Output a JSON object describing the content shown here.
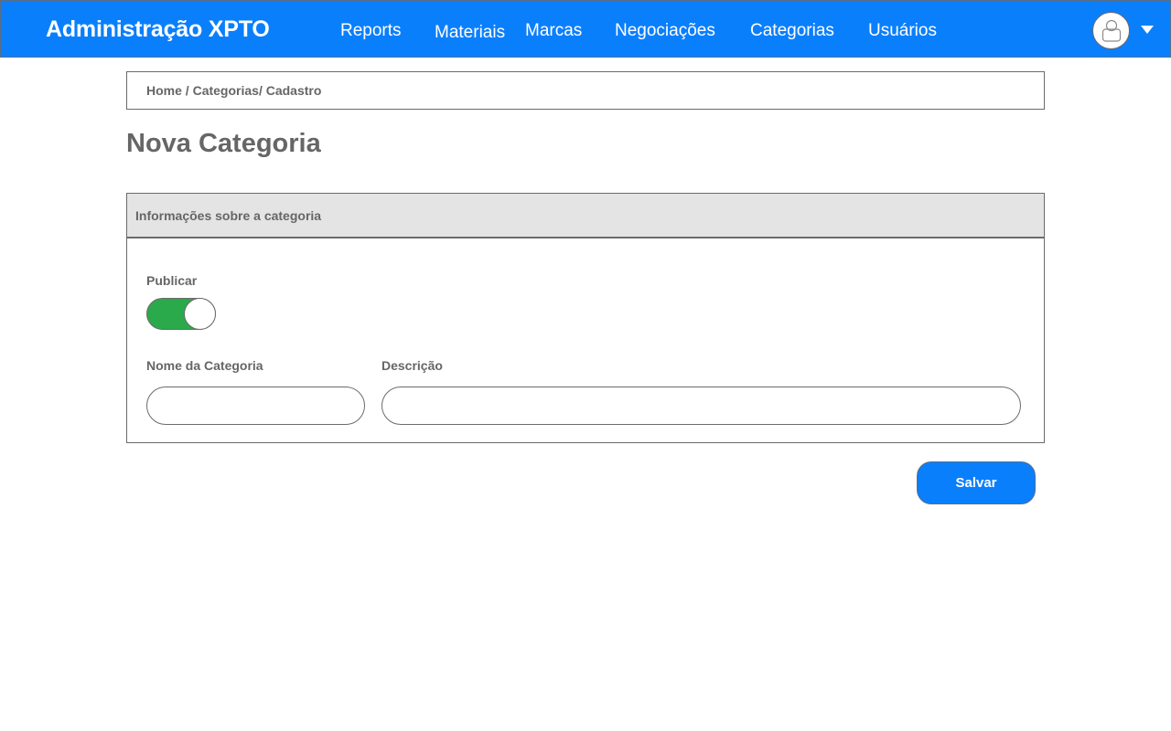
{
  "app": {
    "title": "Administração XPTO"
  },
  "nav": {
    "items": [
      {
        "label": "Reports"
      },
      {
        "label": "Materiais"
      },
      {
        "label": "Marcas"
      },
      {
        "label": "Negociações"
      },
      {
        "label": "Categorias"
      },
      {
        "label": "Usuários"
      }
    ],
    "user_icon": "user-avatar-icon",
    "dropdown_icon": "caret-down-icon"
  },
  "breadcrumb": {
    "home": "Home",
    "sep1": " / ",
    "categorias": "Categorias",
    "sep2": "/ ",
    "current": "Cadastro"
  },
  "page": {
    "title": "Nova Categoria"
  },
  "panel": {
    "title": "Informações sobre a categoria",
    "publish_label": "Publicar",
    "publish_on": true,
    "name_label": "Nome da Categoria",
    "name_value": "",
    "description_label": "Descrição",
    "description_value": ""
  },
  "actions": {
    "save_label": "Salvar"
  },
  "colors": {
    "primary": "#0a7ffc",
    "toggle_on": "#2aaa4a",
    "panel_header_bg": "#e4e4e4",
    "text": "#666666"
  }
}
